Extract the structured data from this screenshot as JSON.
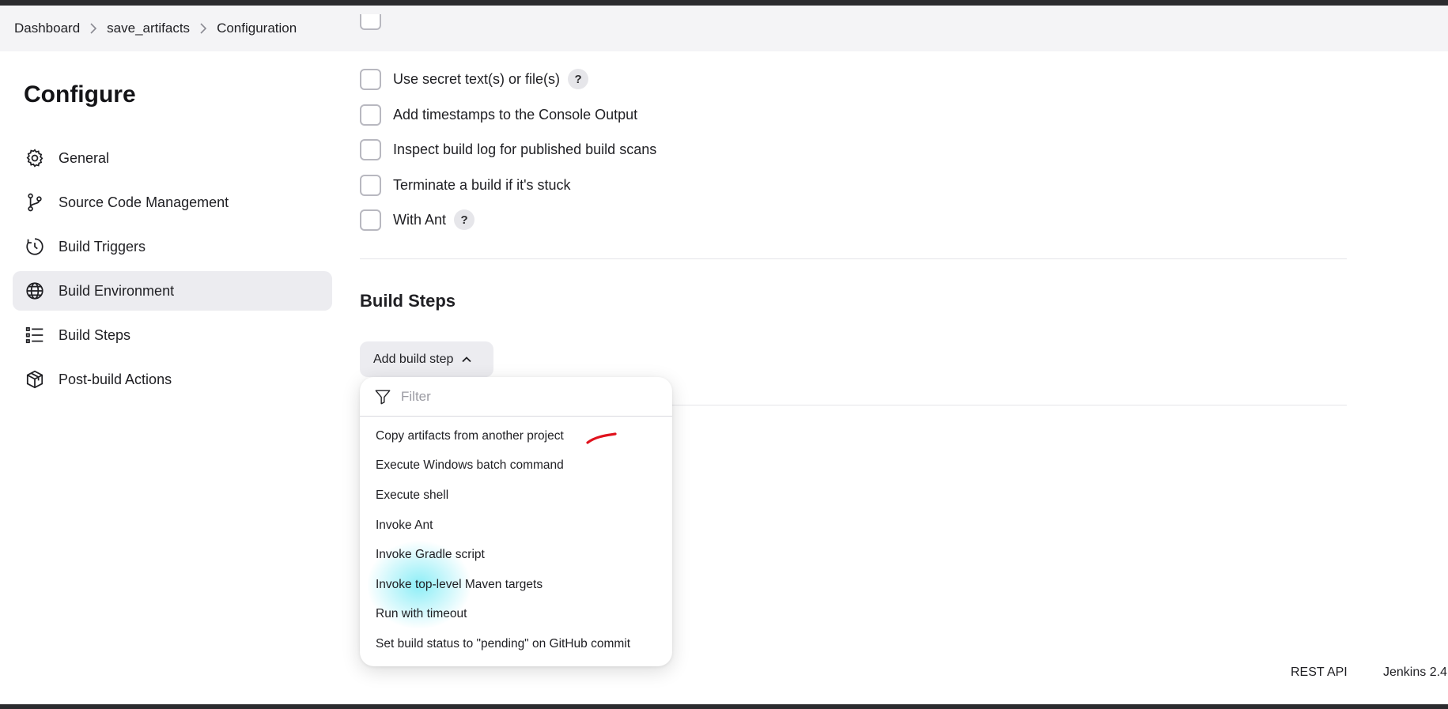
{
  "breadcrumb": [
    "Dashboard",
    "save_artifacts",
    "Configuration"
  ],
  "page_title": "Configure",
  "sidebar": {
    "items": [
      {
        "label": "General",
        "icon": "gear-icon"
      },
      {
        "label": "Source Code Management",
        "icon": "branch-icon"
      },
      {
        "label": "Build Triggers",
        "icon": "clock-icon"
      },
      {
        "label": "Build Environment",
        "icon": "globe-icon",
        "active": true
      },
      {
        "label": "Build Steps",
        "icon": "list-icon"
      },
      {
        "label": "Post-build Actions",
        "icon": "package-icon"
      }
    ]
  },
  "build_environment": {
    "options": [
      {
        "label": "Use secret text(s) or file(s)",
        "help": "?"
      },
      {
        "label": "Add timestamps to the Console Output"
      },
      {
        "label": "Inspect build log for published build scans"
      },
      {
        "label": "Terminate a build if it's stuck"
      },
      {
        "label": "With Ant",
        "help": "?"
      }
    ]
  },
  "build_steps": {
    "title": "Build Steps",
    "add_button": "Add build step",
    "dropdown": {
      "filter_placeholder": "Filter",
      "items": [
        "Copy artifacts from another project",
        "Execute Windows batch command",
        "Execute shell",
        "Invoke Ant",
        "Invoke Gradle script",
        "Invoke top-level Maven targets",
        "Run with timeout",
        "Set build status to \"pending\" on GitHub commit"
      ]
    }
  },
  "footer": {
    "rest_api": "REST API",
    "version": "Jenkins 2.4"
  }
}
